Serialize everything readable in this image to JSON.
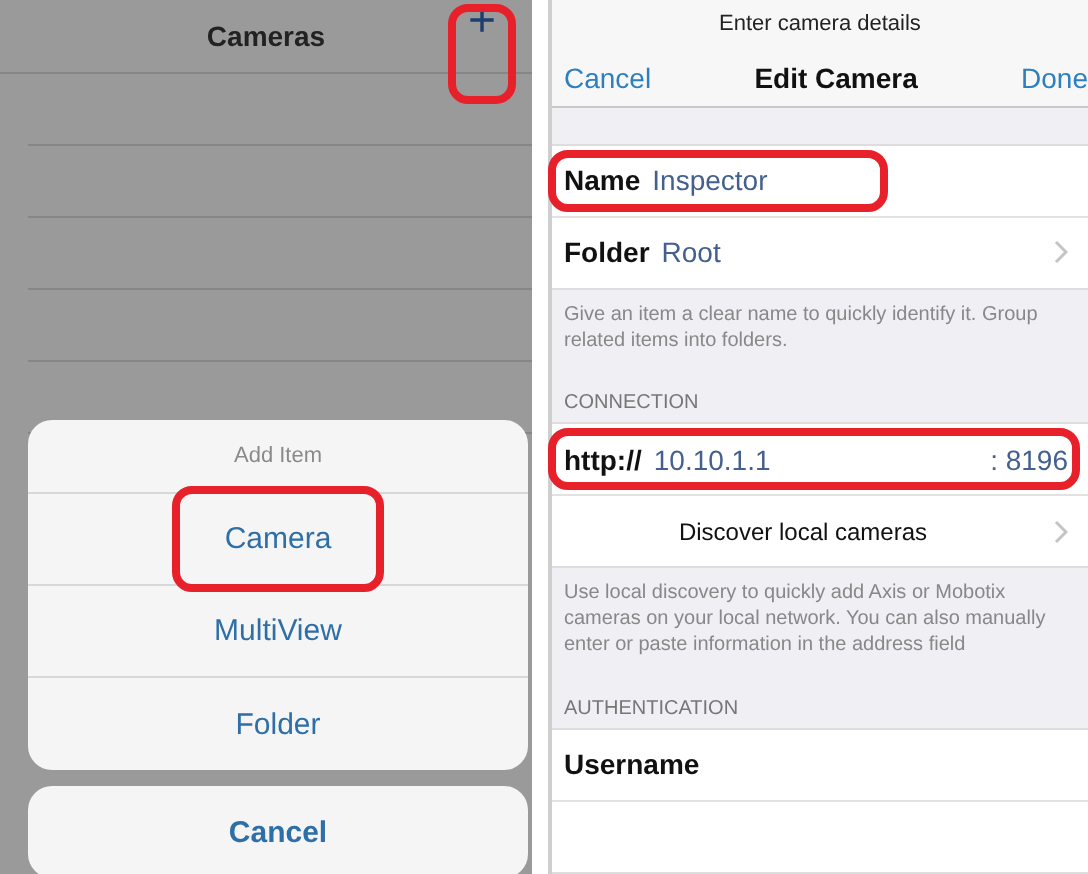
{
  "left_screen": {
    "nav": {
      "title": "Cameras",
      "add_button": {
        "label": "+",
        "highlighted": true
      }
    },
    "action_sheet": {
      "title": "Add Item",
      "items": [
        {
          "label": "Camera",
          "highlighted": true
        },
        {
          "label": "MultiView",
          "highlighted": false
        },
        {
          "label": "Folder",
          "highlighted": false
        }
      ],
      "cancel": "Cancel"
    }
  },
  "right_screen": {
    "prompt": "Enter camera details",
    "nav": {
      "cancel": "Cancel",
      "title": "Edit Camera",
      "done": "Done"
    },
    "sections": [
      {
        "rows": [
          {
            "kind": "field",
            "label": "Name",
            "value": "Inspector",
            "highlighted": true
          },
          {
            "kind": "link",
            "label": "Folder",
            "value": "Root",
            "highlighted": false
          }
        ],
        "footer": "Give an item a clear name to quickly identify it. Group related items into folders."
      },
      {
        "header": "CONNECTION",
        "rows": [
          {
            "kind": "address",
            "label": "http://",
            "value": "10.10.1.1",
            "port": ": 8196",
            "highlighted": true
          },
          {
            "kind": "action",
            "label": "Discover local cameras",
            "highlighted": false
          }
        ],
        "footer": "Use local discovery to quickly add Axis or Mobotix cameras on your local network. You can also manually enter or paste information in the address field"
      },
      {
        "header": "AUTHENTICATION",
        "rows": [
          {
            "kind": "field",
            "label": "Username",
            "highlighted": false
          },
          {
            "kind": "blank",
            "highlighted": false
          }
        ]
      }
    ]
  }
}
